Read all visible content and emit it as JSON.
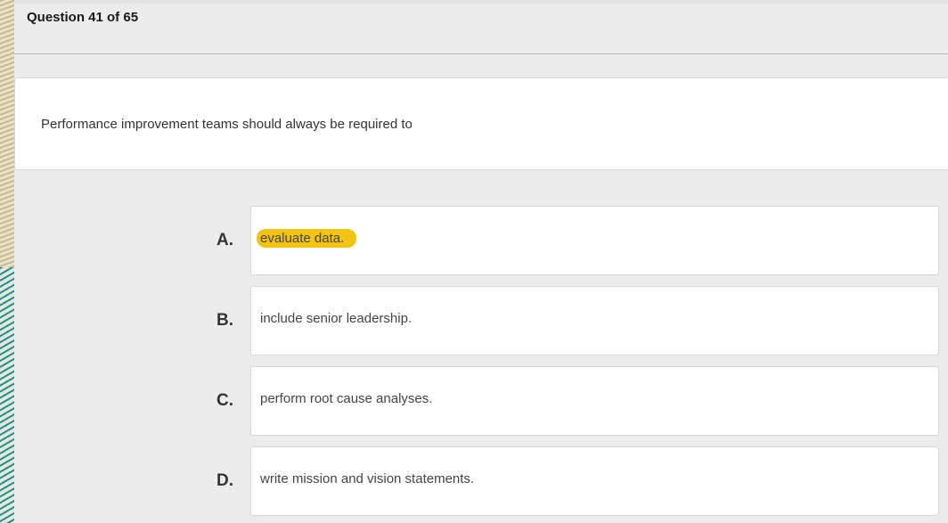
{
  "header": {
    "question_counter": "Question 41 of 65"
  },
  "question": {
    "text": "Performance improvement teams should always be required to"
  },
  "options": [
    {
      "letter": "A.",
      "text": "evaluate data.",
      "highlighted": true
    },
    {
      "letter": "B.",
      "text": "include senior leadership.",
      "highlighted": false
    },
    {
      "letter": "C.",
      "text": "perform root cause analyses.",
      "highlighted": false
    },
    {
      "letter": "D.",
      "text": "write mission and vision statements.",
      "highlighted": false
    }
  ],
  "colors": {
    "highlight": "#f2c40f",
    "background": "#ececec",
    "card": "#ffffff"
  }
}
